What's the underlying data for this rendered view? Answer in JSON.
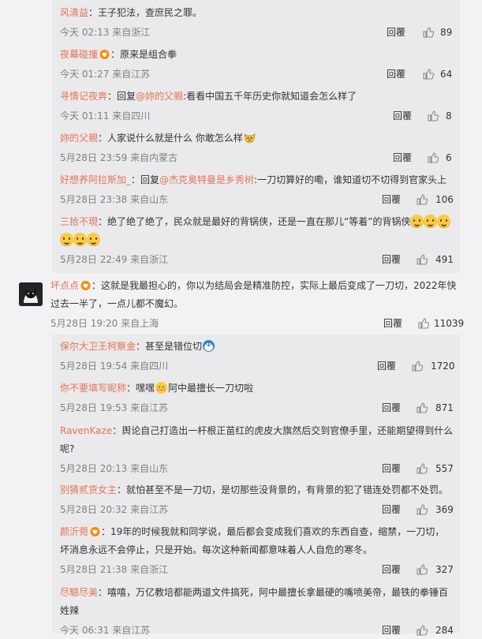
{
  "comments": [
    {
      "user": "风清益",
      "pre": "：王子犯法，查庶民之罪。",
      "time": "今天 02:13 来自浙江",
      "reply_label": "回覆",
      "likes": "89"
    },
    {
      "user": "夜幕碰撞",
      "pre": "：原来是组合拳",
      "time": "今天 01:27 来自江苏",
      "reply_label": "回覆",
      "likes": "64"
    },
    {
      "user": "寻情记夜奔",
      "pre": "：回复",
      "mention": "@妳的父親",
      "post": ":看看中国五千年历史你就知道会怎么样了",
      "time": "今天 01:11 来自四川",
      "reply_label": "回覆",
      "likes": "8"
    },
    {
      "user": "妳的父親",
      "pre": "：人家说什么就是什么 你敢怎么样",
      "time": "5月28日 23:59 来自内蒙古",
      "reply_label": "回覆",
      "likes": "6"
    },
    {
      "user": "好想养阿拉斯加_",
      "pre": "：回复",
      "mention": "@杰克奥特曼是乡秀树",
      "post": ":一刀切算好的嘞，谁知道切不切得到官家头上",
      "time": "5月28日 23:38 来自山东",
      "reply_label": "回覆",
      "likes": "106"
    },
    {
      "user": "三拾不現",
      "pre": "：绝了绝了绝了，民众就是最好的背锅侠，还是一直在那儿“等着”的背锅侠",
      "time": "5月28日 22:49 来自浙江",
      "reply_label": "回覆",
      "likes": "491"
    },
    {
      "user": "坏点点",
      "pre": "：这就是我最担心的，你以为结局会是精准防控，实际上最后变成了一刀切，2022年快",
      "line2": "过去一半了，一点儿都不魔幻。",
      "time": "5月28日 19:20 来自上海",
      "reply_label": "回覆",
      "likes": "11039"
    },
    {
      "user": "保尔大卫王柯察金",
      "pre": "：甚至是错位切",
      "time": "5月28日 19:54 来自四川",
      "reply_label": "回覆",
      "likes": "1720"
    },
    {
      "user": "你不要填写昵称",
      "pre": "：嘿嘿",
      "post": "阿中最擅长一刀切啦",
      "time": "5月28日 19:53 来自江苏",
      "reply_label": "回覆",
      "likes": "871"
    },
    {
      "user": "RavenKaze",
      "pre": "：舆论自己打造出一杆根正苗红的虎皮大旗然后交到官僚手里，还能期望得到什么",
      "line2": "呢?",
      "time": "5月28日 20:13 来自山东",
      "reply_label": "回覆",
      "likes": "557"
    },
    {
      "user": "别猜贰货女主",
      "pre": "：就怕甚至不是一刀切，是切那些没背景的，有背景的犯了错连处罚都不处罚。",
      "time": "5月28日 20:32 来自江苏",
      "reply_label": "回覆",
      "likes": "369"
    },
    {
      "user": "颜沂菀",
      "pre": "：19年的时候我就和同学说，最后都会变成我们喜欢的东西自查，缩禁，一刀切，",
      "line2": "坏消息永远不会停止，只是开始。每次这种新闻都意味着人人自危的寒冬。",
      "time": "5月28日 21:38 来自浙江",
      "reply_label": "回覆",
      "likes": "327"
    },
    {
      "user": "尽驄尽美",
      "pre": "：嘻嘻，万亿教培都能两道文件搞死，阿中最擅长拿最硬的嘴喷美帝，最铁的拳锤百",
      "line2": "姓辣",
      "time": "今天 06:31 来自江苏",
      "reply_label": "回覆",
      "likes": "284"
    }
  ]
}
